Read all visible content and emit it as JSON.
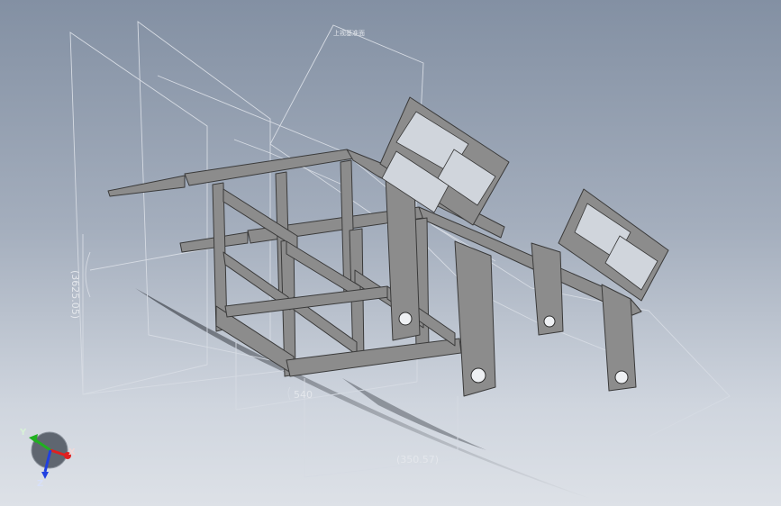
{
  "window": {
    "background_top": "#8390a3",
    "background_bottom": "#dde1e7"
  },
  "model": {
    "steel_color": "#8c8c8c",
    "steel_edge": "#3a3a3a",
    "sketch_color": "#d6dbe3"
  },
  "plane_label": "上视基准面",
  "dimensions": {
    "height": "(3625.05)",
    "width": "540",
    "depth": "(350.57)"
  },
  "triad": {
    "x_label": "X",
    "y_label": "Y",
    "z_label": "Z",
    "x_color": "#e02020",
    "y_color": "#20b020",
    "z_color": "#2040e0"
  }
}
